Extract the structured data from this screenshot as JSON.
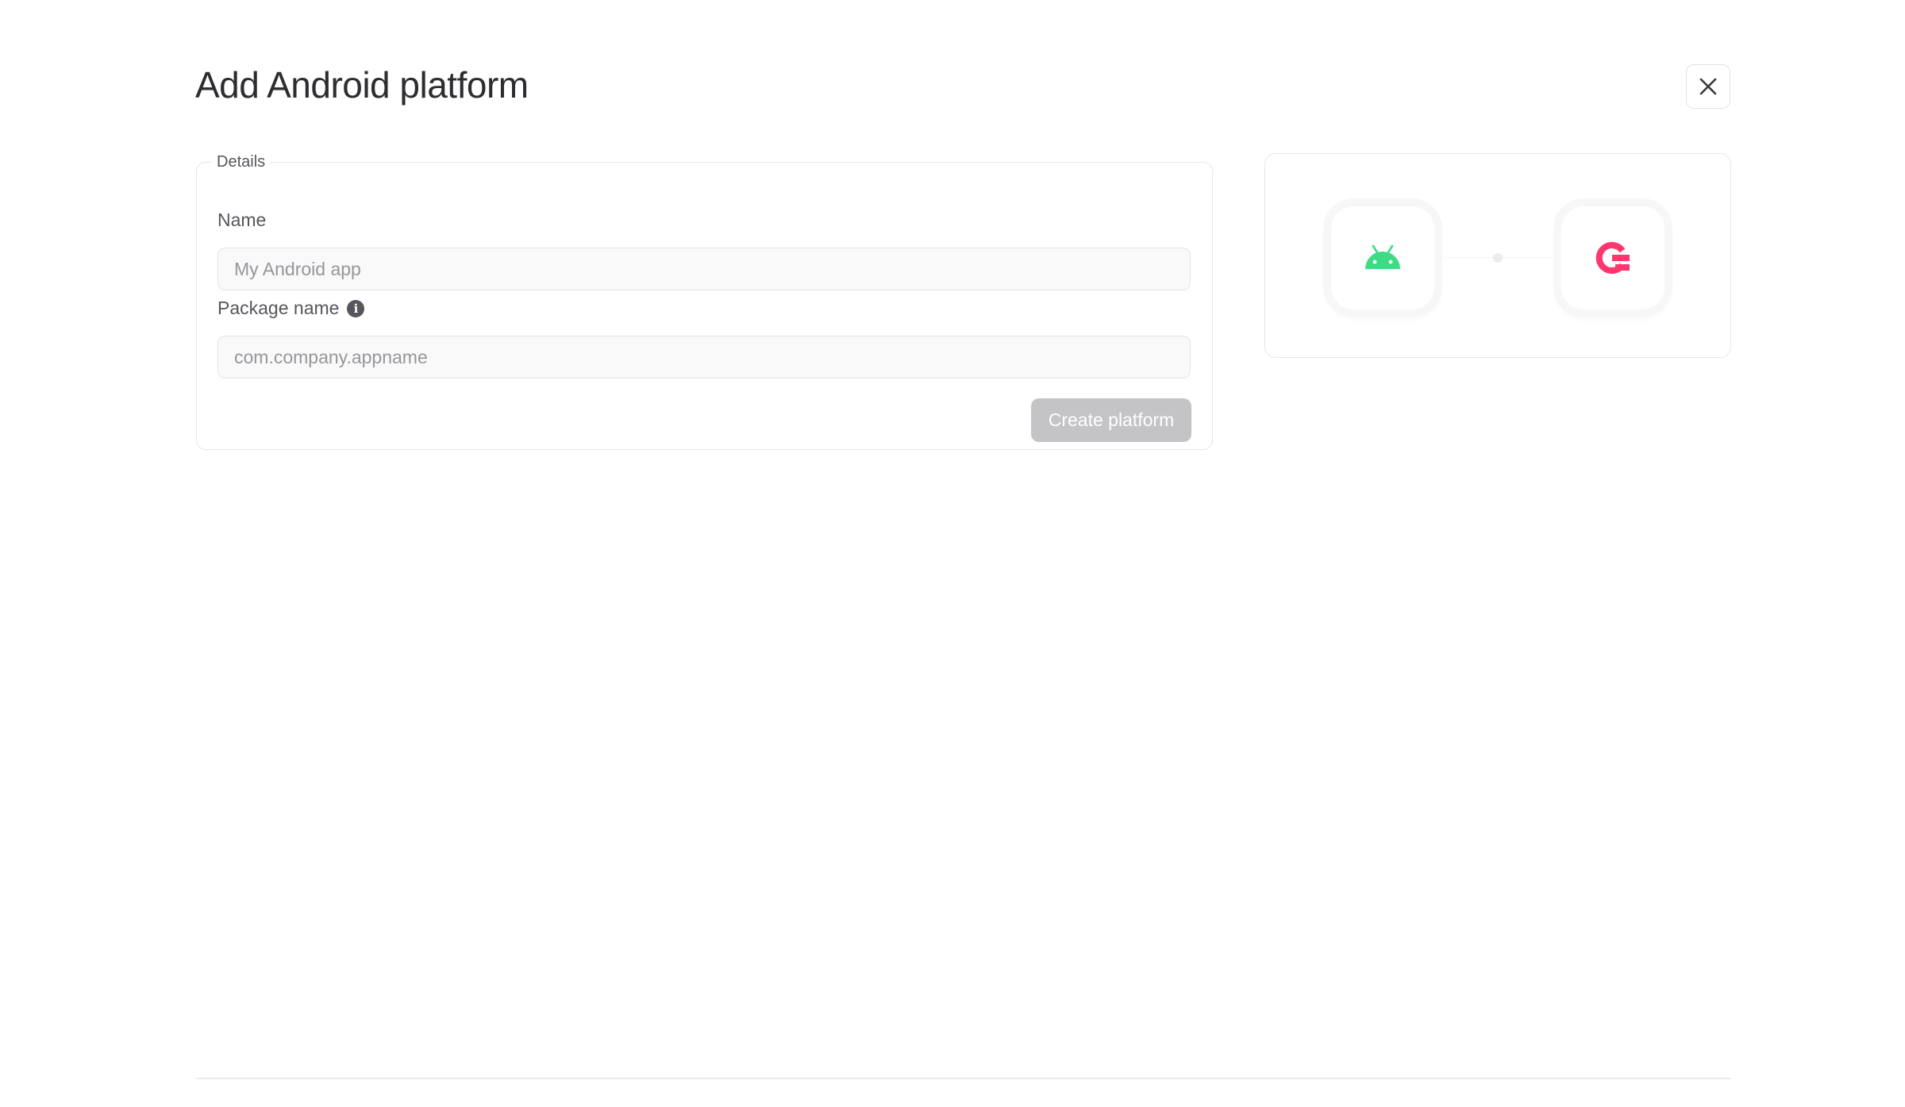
{
  "modal": {
    "title": "Add Android platform",
    "close_icon": "close-icon"
  },
  "details": {
    "legend": "Details",
    "name": {
      "label": "Name",
      "value": "",
      "placeholder": "My Android app"
    },
    "package_name": {
      "label": "Package name",
      "info_icon": "info-icon",
      "value": "",
      "placeholder": "com.company.appname"
    },
    "create_button": "Create platform"
  },
  "preview": {
    "platform_icon": "android-icon",
    "service_icon": "appwrite-icon"
  },
  "colors": {
    "android_green": "#3ddc84",
    "appwrite_pink": "#fd366e",
    "button_disabled": "#c4c4c7"
  }
}
